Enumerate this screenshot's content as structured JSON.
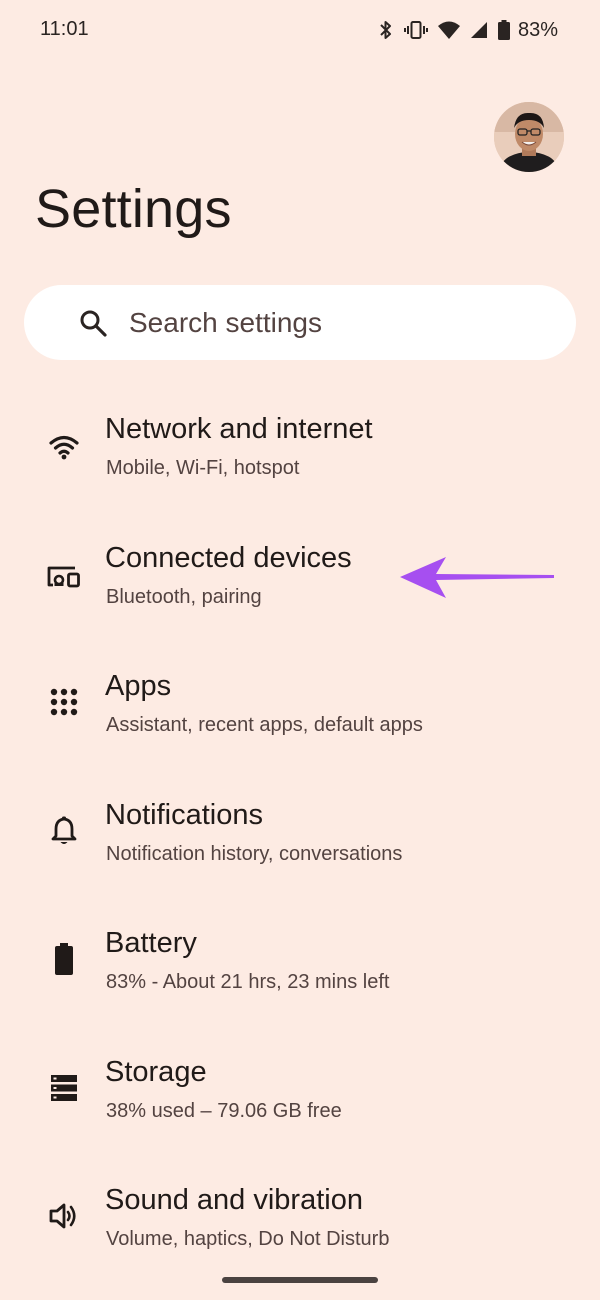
{
  "status_bar": {
    "time": "11:01",
    "battery_percent": "83%",
    "icons": [
      "bluetooth-icon",
      "vibrate-icon",
      "wifi-icon",
      "cell-signal-icon",
      "battery-icon"
    ]
  },
  "header": {
    "title": "Settings"
  },
  "search": {
    "placeholder": "Search settings"
  },
  "settings_items": [
    {
      "icon": "wifi-icon",
      "title": "Network and internet",
      "subtitle": "Mobile, Wi-Fi, hotspot"
    },
    {
      "icon": "connected-devices-icon",
      "title": "Connected devices",
      "subtitle": "Bluetooth, pairing"
    },
    {
      "icon": "apps-grid-icon",
      "title": "Apps",
      "subtitle": "Assistant, recent apps, default apps"
    },
    {
      "icon": "bell-icon",
      "title": "Notifications",
      "subtitle": "Notification history, conversations"
    },
    {
      "icon": "battery-icon",
      "title": "Battery",
      "subtitle": "83% - About 21 hrs, 23 mins left"
    },
    {
      "icon": "storage-icon",
      "title": "Storage",
      "subtitle": "38% used – 79.06 GB free"
    },
    {
      "icon": "volume-icon",
      "title": "Sound and vibration",
      "subtitle": "Volume, haptics, Do Not Disturb"
    }
  ],
  "colors": {
    "background": "#fdebe3",
    "search_background": "#ffffff",
    "annotation_arrow": "#a64ff0",
    "text_primary": "#201a18",
    "text_secondary": "#534341"
  }
}
